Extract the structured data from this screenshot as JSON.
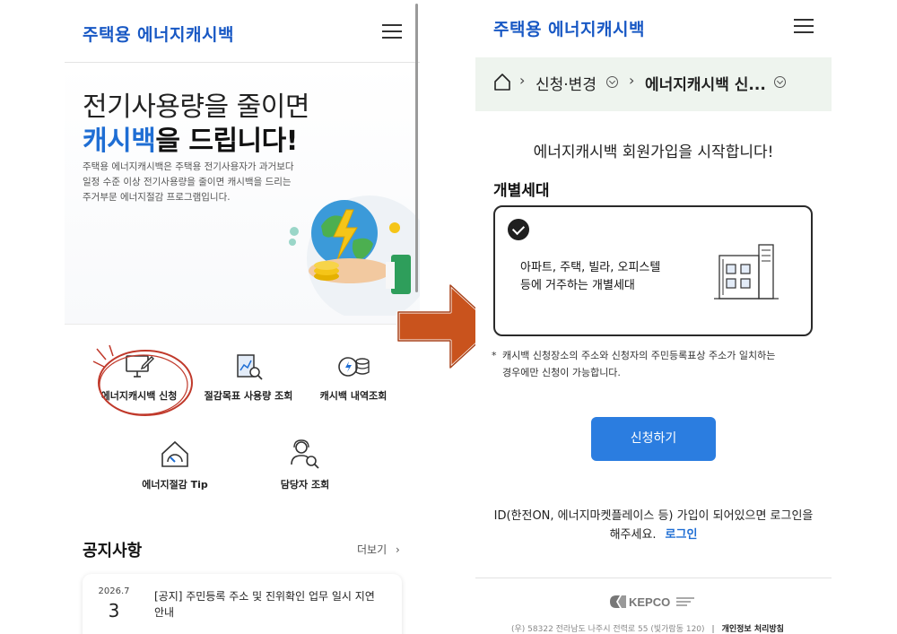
{
  "left": {
    "brand": "주택용 에너지캐시백",
    "hero": {
      "line1": "전기사용량을 줄이면",
      "line2_accent": "캐시백",
      "line2_rest": "을 드립니다!",
      "desc_lines": [
        "주택용 에너지캐시백은 주택용 전기사용자가 과거보다",
        "일정 수준 이상 전기사용량을 줄이면 캐시백을 드리는",
        "주거부문 에너지절감 프로그램입니다."
      ]
    },
    "menu": [
      {
        "label": "에너지캐시백 신청",
        "icon": "monitor-edit-icon"
      },
      {
        "label": "절감목표 사용량 조회",
        "icon": "chart-search-icon"
      },
      {
        "label": "캐시백 내역조회",
        "icon": "cash-coins-icon"
      },
      {
        "label": "에너지절감 Tip",
        "icon": "gauge-home-icon"
      },
      {
        "label": "담당자 조회",
        "icon": "person-search-icon"
      }
    ],
    "notice": {
      "title": "공지사항",
      "more": "더보기",
      "item": {
        "year_month": "2026.7",
        "day": "3",
        "text": "[공지] 주민등록 주소 및 진위확인 업무 일시 지연 안내"
      }
    }
  },
  "right": {
    "brand": "주택용 에너지캐시백",
    "breadcrumb": {
      "step1": "신청·변경",
      "step2": "에너지캐시백 신..."
    },
    "start_message": "에너지캐시백 회원가입을 시작합니다!",
    "section_title": "개별세대",
    "option": {
      "line1": "아파트, 주택, 빌라, 오피스텔",
      "line2": "등에 거주하는 개별세대"
    },
    "note_star": "*",
    "note_line1": "캐시백 신청장소의 주소와 신청자의 주민등록표상 주소가 일치하는",
    "note_line2": "경우에만 신청이 가능합니다.",
    "apply_button": "신청하기",
    "login_line1": "ID(한전ON, 에너지마켓플레이스 등) 가입이 되어있으면 로그인을",
    "login_line2": "해주세요.",
    "login_link": "로그인",
    "footer": {
      "logo_text": "KEPCO",
      "address": "(우) 58322 전라남도 나주시 전력로 55 (빛가람동 120)",
      "divider": "|",
      "privacy": "개인정보 처리방침"
    }
  },
  "colors": {
    "brand_blue": "#1858c4",
    "accent_blue": "#1f6ed4",
    "button_blue": "#2b7de0",
    "breadcrumb_bg": "#eef4ee",
    "annotation_red": "#c0392b",
    "arrow_orange": "#c9531d"
  }
}
